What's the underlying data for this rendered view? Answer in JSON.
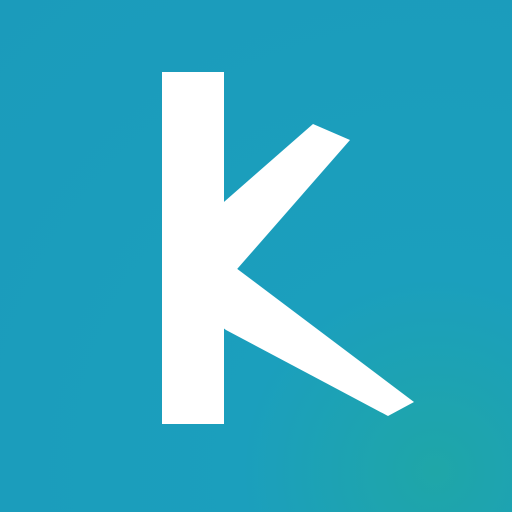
{
  "app_icon": {
    "logo_letter": "k",
    "icon_name": "k-logo-icon",
    "colors": {
      "background": "#1b9bbb",
      "glyph": "#ffffff"
    }
  }
}
